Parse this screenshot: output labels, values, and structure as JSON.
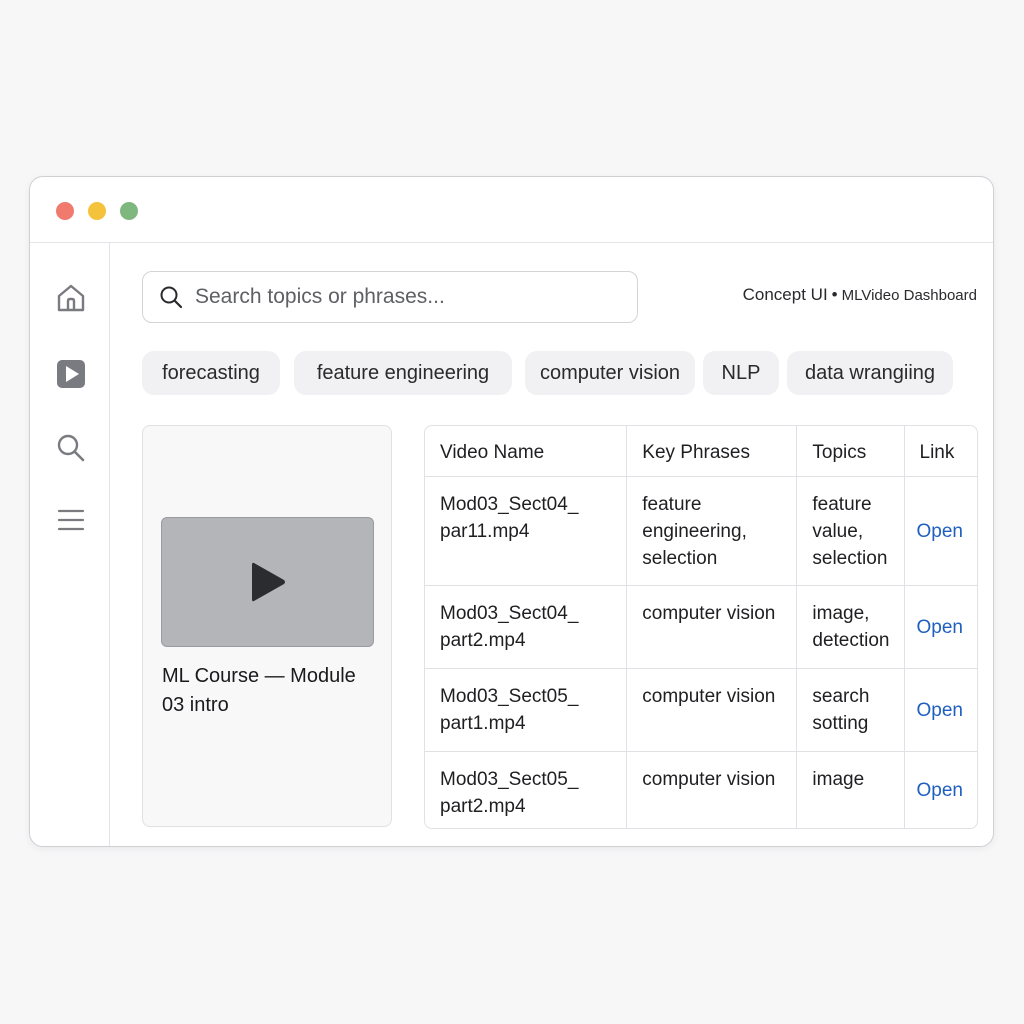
{
  "window": {
    "dots": {
      "red": "#f07a6e",
      "yellow": "#f5c23c",
      "green": "#7fb87f"
    }
  },
  "sidebar": {
    "items": [
      {
        "icon": "home-icon"
      },
      {
        "icon": "video-icon"
      },
      {
        "icon": "search-icon"
      },
      {
        "icon": "menu-icon"
      }
    ]
  },
  "search": {
    "placeholder": "Search topics or phrases..."
  },
  "brand": {
    "left": "Concept UI",
    "separator": "•",
    "right": "MLVideo Dashboard"
  },
  "chips": [
    "forecasting",
    "feature engineering",
    "computer vision",
    "NLP",
    "data wrangiing"
  ],
  "featured": {
    "title": "ML Course — Module 03 intro"
  },
  "table": {
    "headers": [
      "Video Name",
      "Key Phrases",
      "Topics",
      "Link"
    ],
    "rows": [
      {
        "name": "Mod03_Sect04_ par11.mp4",
        "phrases": "feature engineering, selection",
        "topics": "feature value, selection",
        "link": "Open"
      },
      {
        "name": "Mod03_Sect04_ part2.mp4",
        "phrases": "computer vision",
        "topics": "image, detection",
        "link": "Open"
      },
      {
        "name": "Mod03_Sect05_ part1.mp4",
        "phrases": "computer vision",
        "topics": "search sotting",
        "link": "Open"
      },
      {
        "name": "Mod03_Sect05_ part2.mp4",
        "phrases": "computer vision",
        "topics": "image",
        "link": "Open"
      }
    ]
  },
  "colors": {
    "accent_link": "#1f5fbf",
    "chip_bg": "#f1f1f3",
    "icon_gray": "#7a7b80"
  }
}
